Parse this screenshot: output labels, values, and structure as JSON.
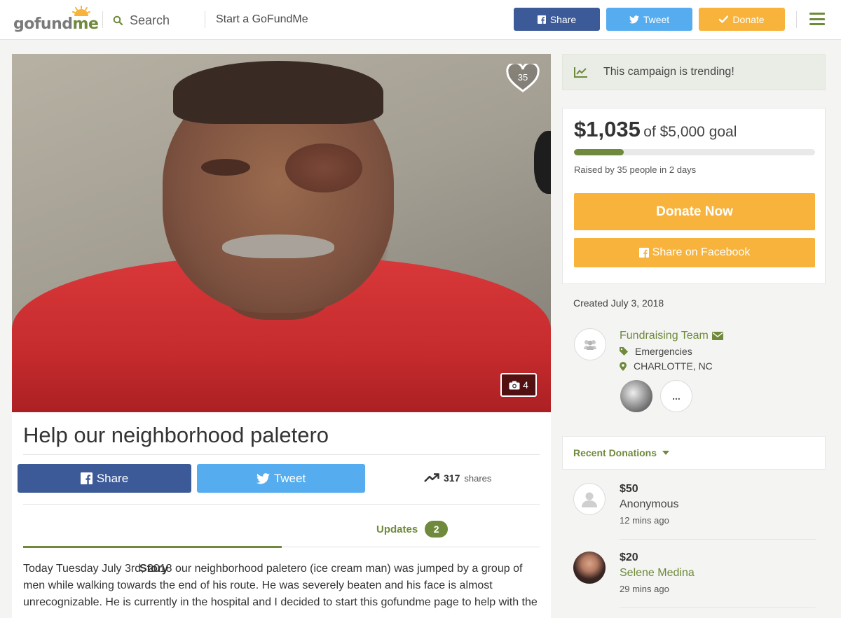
{
  "header": {
    "logo_text_a": "gofund",
    "logo_text_b": "me",
    "search_label": "Search",
    "start_label": "Start a GoFundMe",
    "share_label": "Share",
    "tweet_label": "Tweet",
    "donate_label": "Donate",
    "colors": {
      "facebook": "#3d5a98",
      "twitter": "#55acee",
      "donate": "#f7b33b",
      "brand_green": "#6f8a3c"
    }
  },
  "campaign": {
    "hearts": "35",
    "photo_count": "4",
    "title": "Help our neighborhood paletero",
    "share_label": "Share",
    "tweet_label": "Tweet",
    "shares_count": "317",
    "shares_label": "shares",
    "tabs": {
      "story": "Story",
      "updates": "Updates",
      "updates_count": "2"
    },
    "story_lines": [
      "Today Tuesday July 3rd, 2018 our neighborhood paletero (ice cream man) was jumped by a group of",
      "men while walking towards the end of his route. He was severely beaten and his face is almost",
      "unrecognizable. He is currently in the hospital and I decided to start this gofundme page to help with the"
    ]
  },
  "sidebar": {
    "trending": "This campaign is trending!",
    "raised_amount": "$1,035",
    "goal_text": "of $5,000 goal",
    "progress_fraction": 0.207,
    "raised_by": "Raised by 35 people in 2 days",
    "donate_now": "Donate Now",
    "share_facebook": "Share on Facebook",
    "created": "Created July 3, 2018",
    "team_name": "Fundraising Team",
    "category": "Emergencies",
    "location": "CHARLOTTE, NC",
    "more": "...",
    "recent_donations": "Recent Donations",
    "donations": [
      {
        "amount": "$50",
        "name": "Anonymous",
        "time": "12 mins ago"
      },
      {
        "amount": "$20",
        "name": "Selene Medina",
        "time": "29 mins ago"
      }
    ]
  }
}
